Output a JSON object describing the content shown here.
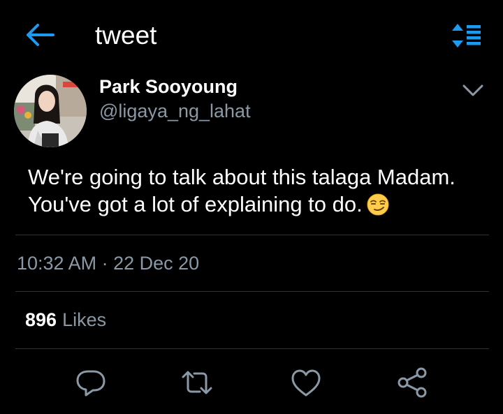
{
  "header": {
    "title": "tweet",
    "back_icon": "arrow-left-icon",
    "sort_icon": "sort-list-icon"
  },
  "author": {
    "name": "Park Sooyoung",
    "handle": "@ligaya_ng_lahat"
  },
  "tweet": {
    "line1": "We're going to talk about this talaga Madam.",
    "line2": "You've got a lot of explaining to do.",
    "emoji": "smirking-face"
  },
  "meta": {
    "timestamp": "10:32 AM · 22 Dec 20"
  },
  "stats": {
    "likes_count": "896",
    "likes_label": "Likes"
  },
  "actions": [
    {
      "name": "reply",
      "icon": "reply-icon"
    },
    {
      "name": "retweet",
      "icon": "retweet-icon"
    },
    {
      "name": "like",
      "icon": "heart-icon"
    },
    {
      "name": "share",
      "icon": "share-icon"
    }
  ],
  "colors": {
    "background": "#000000",
    "accent": "#1d9bf0",
    "secondary_text": "#8b98a5",
    "divider": "#2f3336"
  }
}
